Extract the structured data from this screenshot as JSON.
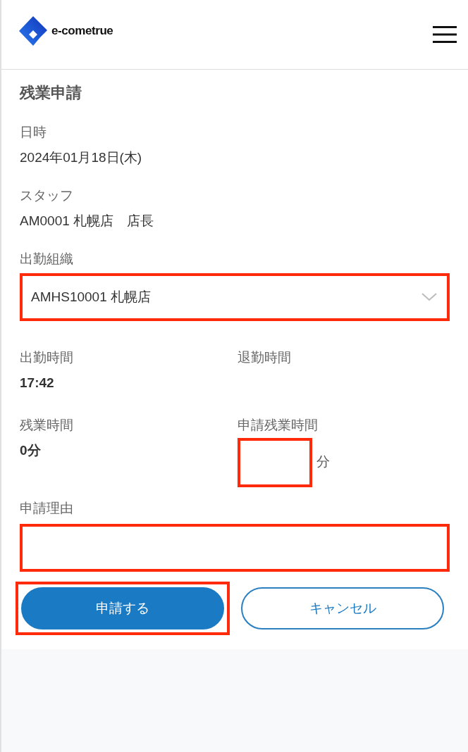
{
  "header": {
    "logo_text": "e-cometrue"
  },
  "title": "残業申請",
  "fields": [
    {
      "label": "日時",
      "value": "2024年01月18日(木)"
    },
    {
      "label": "スタッフ",
      "value": "AM0001 札幌店　店長"
    }
  ],
  "organization": {
    "label": "出勤組織",
    "value": "AMHS10001 札幌店",
    "highlighted": true
  },
  "times": [
    {
      "label": "出勤時間",
      "kind": "text",
      "value": "17:42"
    },
    {
      "label": "退勤時間",
      "kind": "text"
    },
    {
      "label": "残業時間",
      "kind": "text",
      "value": "0分"
    },
    {
      "label": "申請残業時間",
      "kind": "input",
      "unit": "分",
      "highlighted": true
    }
  ],
  "reason": {
    "label": "申請理由",
    "highlighted": true
  },
  "buttons": [
    {
      "label": "申請する",
      "kind": "primary",
      "highlighted": true
    },
    {
      "label": "キャンセル",
      "kind": "secondary"
    }
  ]
}
